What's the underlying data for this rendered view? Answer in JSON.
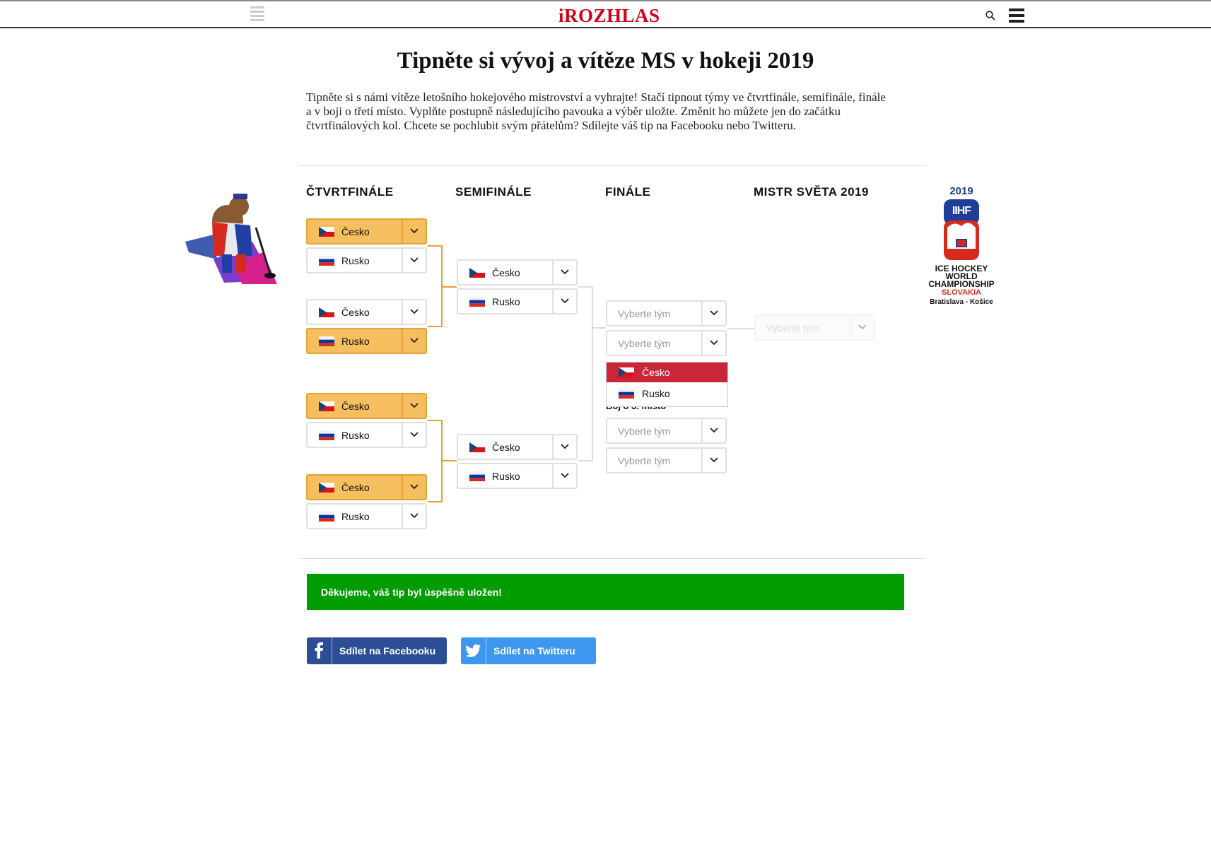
{
  "header": {
    "logo": "iROZHLAS"
  },
  "page": {
    "title": "Tipněte si vývoj a vítěze MS v hokeji 2019",
    "intro": "Tipněte si s námi vítěze letošního hokejového mistrovství a vyhrajte! Stačí tipnout týmy ve čtvrtfinále, semifinále, finále a v boji o třetí místo. Vyplňte postupně následujícího pavouka a výběr uložte. Změnit ho můžete jen do začátku čtvrtfinálových kol. Chcete se pochlubit svým přátelům? Sdílejte váš tip na Facebooku nebo Twitteru."
  },
  "columns": [
    "ČTVRTFINÁLE",
    "SEMIFINÁLE",
    "FINÁLE",
    "MISTR SVĚTA 2019"
  ],
  "quarterfinals": [
    {
      "team": "Česko",
      "selected": true
    },
    {
      "team": "Rusko",
      "selected": false
    },
    {
      "team": "Česko",
      "selected": false
    },
    {
      "team": "Rusko",
      "selected": true
    },
    {
      "team": "Česko",
      "selected": true
    },
    {
      "team": "Rusko",
      "selected": false
    },
    {
      "team": "Česko",
      "selected": true
    },
    {
      "team": "Rusko",
      "selected": false
    }
  ],
  "semifinals": [
    {
      "team": "Česko"
    },
    {
      "team": "Rusko"
    },
    {
      "team": "Česko"
    },
    {
      "team": "Rusko"
    }
  ],
  "final": {
    "placeholder_1": "Vyberte tým",
    "placeholder_2": "Vyberte tým"
  },
  "dropdown_options": [
    {
      "team": "Česko",
      "highlighted": true
    },
    {
      "team": "Rusko",
      "highlighted": false
    }
  ],
  "third_place": {
    "label": "Boj o 3. místo",
    "placeholder_1": "Vyberte tým",
    "placeholder_2": "Vyberte tým"
  },
  "champion": {
    "placeholder": "Vyberte tým"
  },
  "logo_iihf": {
    "year": "2019",
    "mark": "IIHF",
    "line1": "ICE HOCKEY",
    "line2": "WORLD",
    "line3": "CHAMPIONSHIP",
    "line4": "SLOVAKIA",
    "line5": "Bratislava - Košice"
  },
  "success_message": "Děkujeme, váš tip byl úspěšně uložen!",
  "share": {
    "facebook": "Sdílet na Facebooku",
    "twitter": "Sdílet na Twitteru"
  },
  "colors": {
    "brand_red": "#d0021b",
    "selected": "#f5be5e",
    "bracket_line": "#e8a02f",
    "success": "#009c00",
    "facebook": "#2d4d94",
    "twitter": "#3d97ee",
    "dropdown_active": "#c9263a"
  }
}
